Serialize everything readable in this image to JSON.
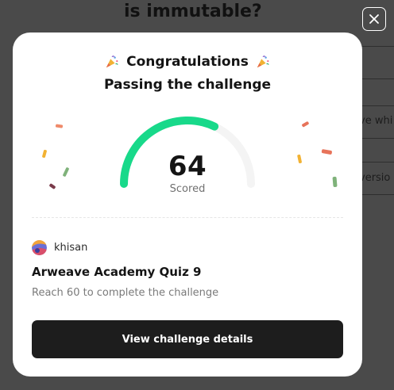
{
  "background": {
    "question_title": "is immutable?",
    "option_texts": [
      ".",
      "ve whi",
      "versio"
    ]
  },
  "close_button": {
    "icon": "close-icon"
  },
  "modal": {
    "congrats_title": "Congratulations",
    "title_icon": "party-popper-icon",
    "subtitle": "Passing the challenge",
    "score": "64",
    "score_label": "Scored",
    "score_fraction": 0.64,
    "author": {
      "name": "khisan",
      "avatar_icon": "avatar"
    },
    "quiz_title": "Arweave Academy Quiz 9",
    "quiz_description": "Reach 60 to complete the challenge",
    "details_button_label": "View challenge details"
  },
  "colors": {
    "gauge_progress": "#18d98a",
    "gauge_track": "#f4f4f4",
    "button_bg": "#1d1d1d",
    "overlay_bg": "#4a4a4a"
  }
}
